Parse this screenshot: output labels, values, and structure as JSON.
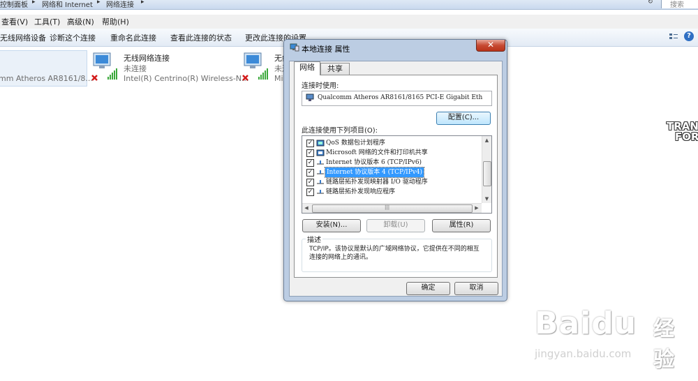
{
  "explorer": {
    "breadcrumb": [
      "控制面板",
      "网络和 Internet",
      "网络连接"
    ],
    "search_placeholder": "搜索",
    "menu": [
      "查看(V)",
      "工具(T)",
      "高级(N)",
      "帮助(H)"
    ],
    "toolbar": [
      "无线网络设备",
      "诊断这个连接",
      "重命名此连接",
      "查看此连接的状态",
      "更改此连接的设置"
    ],
    "help_glyph": "?",
    "connections": [
      {
        "name": "",
        "status": "",
        "device": "mm Atheros AR8161/8..."
      },
      {
        "name": "无线网络连接",
        "status": "未连接",
        "device": "Intel(R) Centrino(R) Wireless-N..."
      },
      {
        "name": "无线",
        "status": "未连",
        "device": "Mi"
      }
    ]
  },
  "dialog": {
    "title": "本地连接 属性",
    "close_glyph": "✕",
    "tabs": [
      "网络",
      "共享"
    ],
    "connect_using_label": "连接时使用:",
    "adapter": "Qualcomm Atheros AR8161/8165 PCI-E Gigabit Eth",
    "configure_label": "配置(C)...",
    "items_label": "此连接使用下列项目(O):",
    "items": [
      {
        "label": "QoS 数据包计划程序",
        "checked": true,
        "icon": "qos-icon"
      },
      {
        "label": "Microsoft 网络的文件和打印机共享",
        "checked": true,
        "icon": "share-icon"
      },
      {
        "label": "Internet 协议版本 6 (TCP/IPv6)",
        "checked": true,
        "icon": "protocol-icon"
      },
      {
        "label": "Internet 协议版本 4 (TCP/IPv4)",
        "checked": true,
        "icon": "protocol-icon",
        "selected": true
      },
      {
        "label": "链路层拓扑发现映射器 I/O 驱动程序",
        "checked": true,
        "icon": "protocol-icon"
      },
      {
        "label": "链路层拓扑发现响应程序",
        "checked": true,
        "icon": "protocol-icon"
      }
    ],
    "check_glyph": "✓",
    "install_label": "安装(N)...",
    "uninstall_label": "卸载(U)",
    "properties_label": "属性(R)",
    "description_legend": "描述",
    "description": "TCP/IP。该协议是默认的广域网络协议，它提供在不同的相互连接的网络上的通讯。",
    "ok_label": "确定",
    "cancel_label": "取消"
  },
  "watermarks": {
    "transformers": [
      "TRAN",
      "FOR"
    ],
    "baidu_logo": "Baidu",
    "baidu_cn": "经验",
    "baidu_url": "jingyan.baidu.com"
  },
  "colors": {
    "selection": "#3399ff",
    "close": "#c74a33",
    "dialog_frame": "#bccde3"
  }
}
